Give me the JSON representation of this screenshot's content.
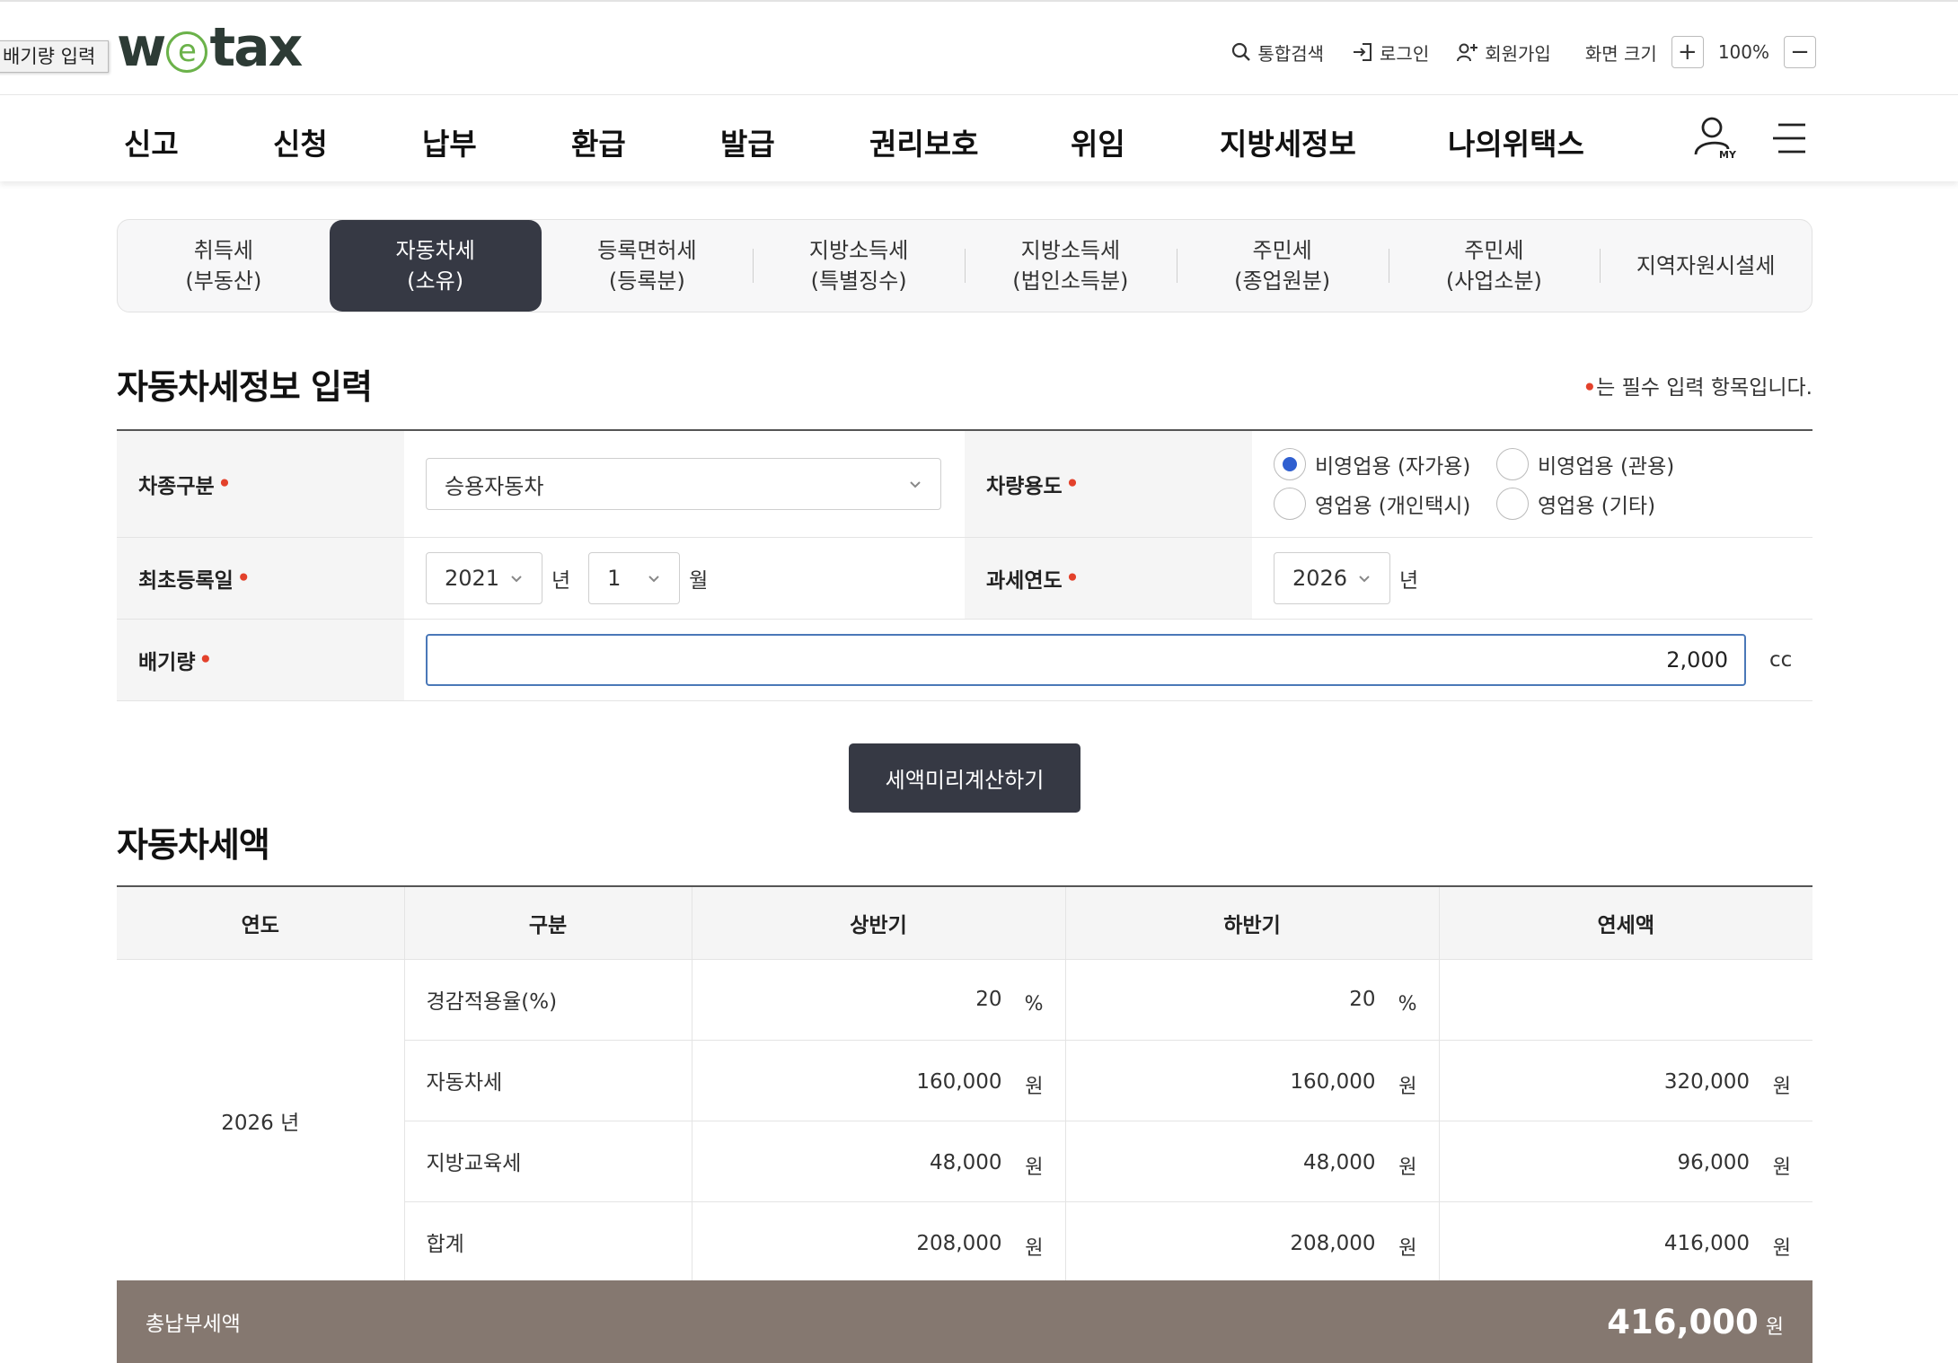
{
  "tooltip": "배기량 입력",
  "header": {
    "logo_w": "w",
    "logo_e": "e",
    "logo_tax": "tax",
    "search": "통합검색",
    "login": "로그인",
    "signup": "회원가입",
    "zoom_label": "화면 크기",
    "zoom_plus": "+",
    "zoom_value": "100%",
    "zoom_minus": "−"
  },
  "gnb": [
    "신고",
    "신청",
    "납부",
    "환급",
    "발급",
    "권리보호",
    "위임",
    "지방세정보",
    "나의위택스"
  ],
  "tabs": [
    {
      "line1": "취득세",
      "line2": "(부동산)"
    },
    {
      "line1": "자동차세",
      "line2": "(소유)"
    },
    {
      "line1": "등록면허세",
      "line2": "(등록분)"
    },
    {
      "line1": "지방소득세",
      "line2": "(특별징수)"
    },
    {
      "line1": "지방소득세",
      "line2": "(법인소득분)"
    },
    {
      "line1": "주민세",
      "line2": "(종업원분)"
    },
    {
      "line1": "주민세",
      "line2": "(사업소분)"
    },
    {
      "line1": "지역자원시설세",
      "line2": ""
    }
  ],
  "active_tab": 1,
  "form": {
    "title": "자동차세정보 입력",
    "required_dot": "•",
    "required_note": "는 필수 입력 항목입니다.",
    "car_type_label": "차종구분",
    "car_type_value": "승용자동차",
    "usage_label": "차량용도",
    "usage_options": [
      "비영업용 (자가용)",
      "비영업용 (관용)",
      "영업용 (개인택시)",
      "영업용 (기타)"
    ],
    "usage_selected": 0,
    "first_reg_label": "최초등록일",
    "first_reg_year": "2021",
    "year_unit": "년",
    "first_reg_month": "1",
    "month_unit": "월",
    "tax_year_label": "과세연도",
    "tax_year_value": "2026",
    "displacement_label": "배기량",
    "displacement_value": "2,000",
    "displacement_unit": "cc",
    "calc_button": "세액미리계산하기"
  },
  "result": {
    "title": "자동차세액",
    "headers": [
      "연도",
      "구분",
      "상반기",
      "하반기",
      "연세액"
    ],
    "year": "2026 년",
    "rows": [
      {
        "cat": "경감적용율(%)",
        "h1": "20",
        "h1u": "%",
        "h2": "20",
        "h2u": "%",
        "annual": "",
        "au": ""
      },
      {
        "cat": "자동차세",
        "h1": "160,000",
        "h1u": "원",
        "h2": "160,000",
        "h2u": "원",
        "annual": "320,000",
        "au": "원"
      },
      {
        "cat": "지방교육세",
        "h1": "48,000",
        "h1u": "원",
        "h2": "48,000",
        "h2u": "원",
        "annual": "96,000",
        "au": "원"
      },
      {
        "cat": "합계",
        "h1": "208,000",
        "h1u": "원",
        "h2": "208,000",
        "h2u": "원",
        "annual": "416,000",
        "au": "원"
      }
    ],
    "total_label": "총납부세액",
    "total_value": "416,000",
    "total_unit": "원"
  },
  "icons": {
    "search": "search-icon",
    "login": "login-icon",
    "signup": "add-user-icon",
    "my": "my-page-icon",
    "menu": "hamburger-menu-icon",
    "select": "chevron-down-icon"
  },
  "colors": {
    "dark_tab": "#363944",
    "required_dot": "#e3412b",
    "radio_on": "#2f5fd0",
    "input_focus": "#4a78b8",
    "total_bar": "#857870",
    "logo_green": "#6bb24a"
  }
}
